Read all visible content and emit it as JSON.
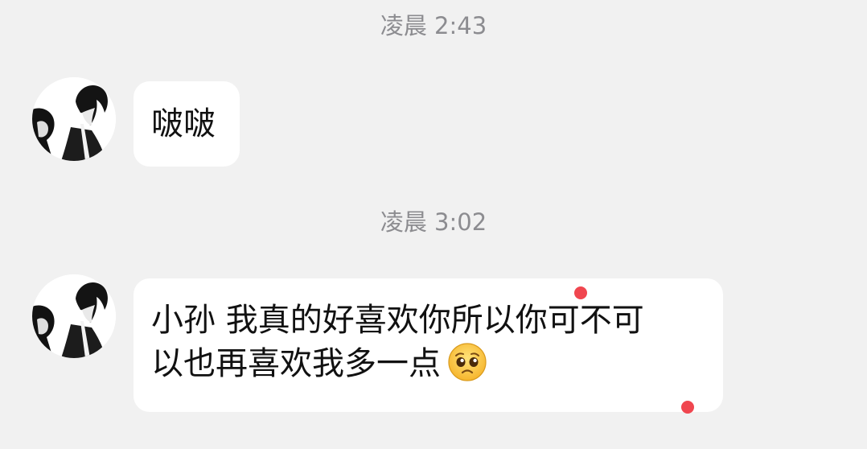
{
  "messages": [
    {
      "timestamp": "凌晨 2:43",
      "text": "啵啵"
    },
    {
      "timestamp": "凌晨 3:02",
      "line1": "小孙 我真的好喜欢你所以你可不可",
      "line2": "以也再喜欢我多一点",
      "emoji": "pleading-face-icon"
    }
  ],
  "colors": {
    "background": "#f1f1f1",
    "bubble": "#ffffff",
    "timestamp_text": "#8c8c90",
    "message_text": "#111111",
    "marker_dot": "#f0464f"
  }
}
